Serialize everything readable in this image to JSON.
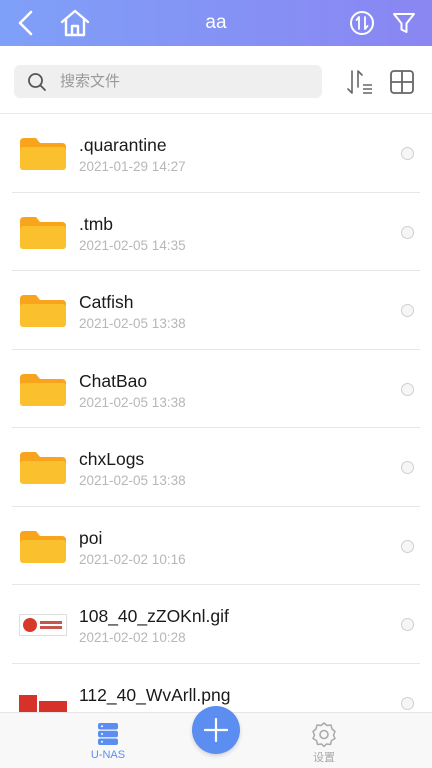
{
  "header": {
    "title": "aa",
    "back_icon": "chevron-left-icon",
    "home_icon": "home-icon",
    "sort_icon": "sort-circle-icon",
    "filter_icon": "filter-icon"
  },
  "search": {
    "placeholder": "搜索文件"
  },
  "toolbar": {
    "sort_icon": "sort-list-icon",
    "grid_icon": "grid-view-icon"
  },
  "files": [
    {
      "name": ".quarantine",
      "date": "2021-01-29 14:27",
      "type": "folder"
    },
    {
      "name": ".tmb",
      "date": "2021-02-05 14:35",
      "type": "folder"
    },
    {
      "name": "Catfish",
      "date": "2021-02-05 13:38",
      "type": "folder"
    },
    {
      "name": "ChatBao",
      "date": "2021-02-05 13:38",
      "type": "folder"
    },
    {
      "name": "chxLogs",
      "date": "2021-02-05 13:38",
      "type": "folder"
    },
    {
      "name": "poi",
      "date": "2021-02-02 10:16",
      "type": "folder"
    },
    {
      "name": "108_40_zZOKnl.gif",
      "date": "2021-02-02 10:28",
      "type": "image"
    },
    {
      "name": "112_40_WvArll.png",
      "date": "",
      "type": "image"
    }
  ],
  "bottom_nav": {
    "nas_label": "U-NAS",
    "settings_label": "设置",
    "add_icon": "plus-icon"
  },
  "colors": {
    "header_start": "#7fa0f8",
    "header_end": "#8a86f2",
    "accent": "#5b8ef0",
    "folder": "#fbbd2a"
  }
}
